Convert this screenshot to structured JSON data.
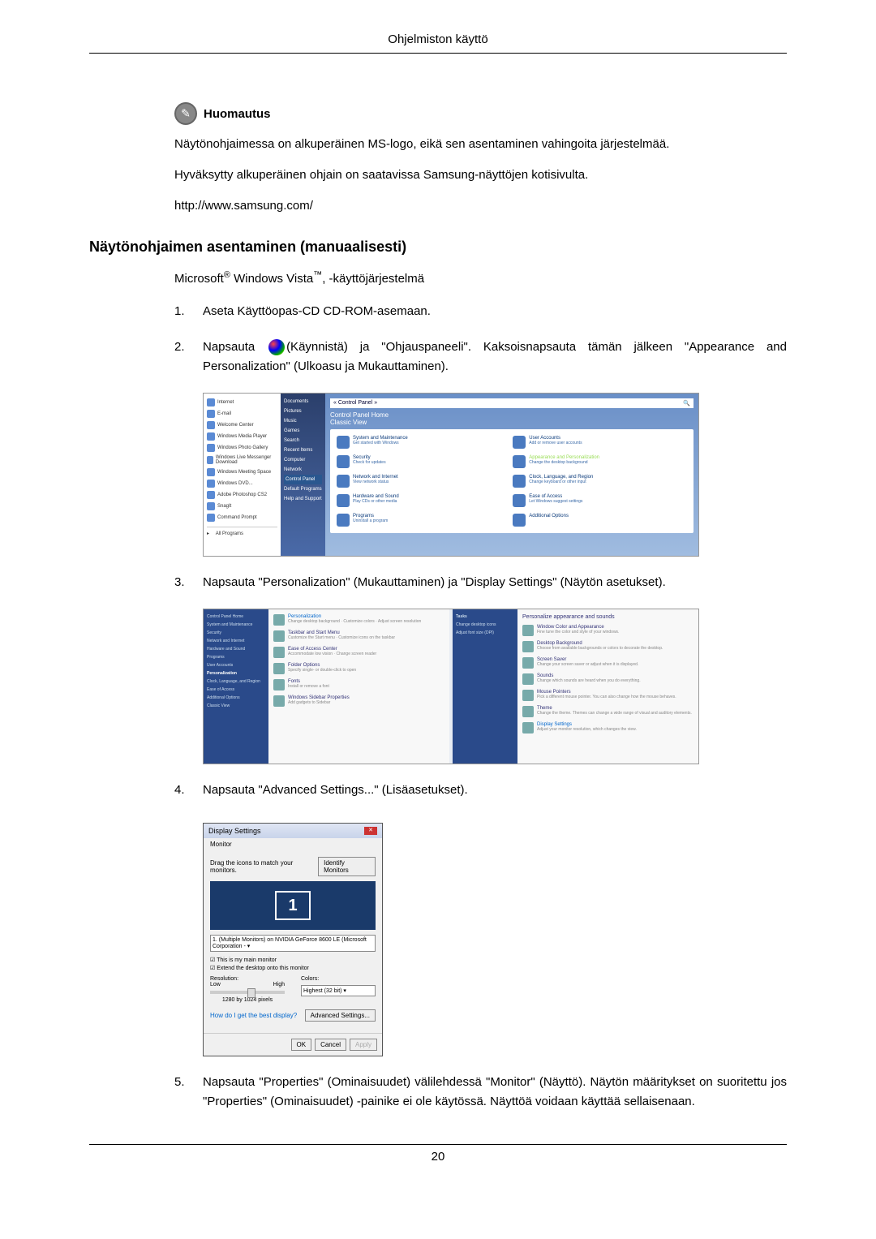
{
  "header": {
    "title": "Ohjelmiston käyttö"
  },
  "note": {
    "heading": "Huomautus",
    "p1": "Näytönohjaimessa on alkuperäinen MS-logo, eikä sen asentaminen vahingoita järjestelmää.",
    "p2": "Hyväksytty alkuperäinen ohjain on saatavissa Samsung-näyttöjen kotisivulta.",
    "p3": "http://www.samsung.com/"
  },
  "section": {
    "heading": "Näytönohjaimen asentaminen (manuaalisesti)"
  },
  "intro": {
    "prefix": "Microsoft",
    "reg": "®",
    "mid": " Windows Vista",
    "tm": "™",
    "suffix": ", -käyttöjärjestelmä"
  },
  "steps": {
    "s1": {
      "num": "1.",
      "text": "Aseta Käyttöopas-CD CD-ROM-asemaan."
    },
    "s2": {
      "num": "2.",
      "pre": "Napsauta ",
      "post": "(Käynnistä) ja \"Ohjauspaneeli\". Kaksoisnapsauta tämän jälkeen \"Appearance and Personalization\" (Ulkoasu ja Mukauttaminen)."
    },
    "s3": {
      "num": "3.",
      "text": "Napsauta \"Personalization\" (Mukauttaminen) ja \"Display Settings\" (Näytön asetukset)."
    },
    "s4": {
      "num": "4.",
      "text": "Napsauta \"Advanced Settings...\" (Lisäasetukset)."
    },
    "s5": {
      "num": "5.",
      "text": "Napsauta \"Properties\" (Ominaisuudet) välilehdessä \"Monitor\" (Näyttö). Näytön määritykset on suoritettu jos \"Properties\" (Ominaisuudet) -painike ei ole käytössä. Näyttöä voidaan käyttää sellaisenaan."
    }
  },
  "cp_screenshot": {
    "addr_path": "« Control Panel »",
    "start_menu_left": [
      "Internet",
      "E-mail",
      "Welcome Center",
      "Windows Media Player",
      "Windows Photo Gallery",
      "Windows Live Messenger Download",
      "Windows Meeting Space",
      "Windows DVD...",
      "Adobe Photoshop CS2",
      "SnagIt",
      "Command Prompt",
      "All Programs"
    ],
    "start_menu_right": [
      "Documents",
      "Pictures",
      "Music",
      "Games",
      "Search",
      "Recent Items",
      "Computer",
      "Network",
      "Control Panel",
      "Default Programs",
      "Help and Support"
    ],
    "cats": [
      {
        "t": "System and Maintenance",
        "s": "Get started with Windows"
      },
      {
        "t": "User Accounts",
        "s": "Add or remove user accounts"
      },
      {
        "t": "Security",
        "s": "Check for updates"
      },
      {
        "t": "Appearance and Personalization",
        "s": "Change the desktop background",
        "hl": true
      },
      {
        "t": "Network and Internet",
        "s": "View network status"
      },
      {
        "t": "Clock, Language, and Region",
        "s": "Change keyboard or other input"
      },
      {
        "t": "Hardware and Sound",
        "s": "Play CDs or other media"
      },
      {
        "t": "Ease of Access",
        "s": "Let Windows suggest settings"
      },
      {
        "t": "Programs",
        "s": "Uninstall a program"
      },
      {
        "t": "Additional Options",
        "s": ""
      }
    ]
  },
  "pers_screenshot": {
    "left_side": [
      "Control Panel Home",
      "System and Maintenance",
      "Security",
      "Network and Internet",
      "Hardware and Sound",
      "Programs",
      "User Accounts",
      "Personalization",
      "Clock, Language, and Region",
      "Ease of Access",
      "Additional Options",
      "Classic View"
    ],
    "left_items": [
      {
        "t": "Personalization",
        "s": "Change desktop background · Customize colors · Adjust screen resolution"
      },
      {
        "t": "Taskbar and Start Menu",
        "s": "Customize the Start menu · Customize icons on the taskbar"
      },
      {
        "t": "Ease of Access Center",
        "s": "Accommodate low vision · Change screen reader"
      },
      {
        "t": "Folder Options",
        "s": "Specify single- or double-click to open"
      },
      {
        "t": "Fonts",
        "s": "Install or remove a font"
      },
      {
        "t": "Windows Sidebar Properties",
        "s": "Add gadgets to Sidebar"
      }
    ],
    "right_side": [
      "Tasks",
      "Change desktop icons",
      "Adjust font size (DPI)"
    ],
    "right_title": "Personalize appearance and sounds",
    "right_items": [
      {
        "t": "Window Color and Appearance",
        "s": "Fine tune the color and style of your windows."
      },
      {
        "t": "Desktop Background",
        "s": "Choose from available backgrounds or colors to decorate the desktop."
      },
      {
        "t": "Screen Saver",
        "s": "Change your screen saver or adjust when it is displayed."
      },
      {
        "t": "Sounds",
        "s": "Change which sounds are heard when you do everything."
      },
      {
        "t": "Mouse Pointers",
        "s": "Pick a different mouse pointer. You can also change how the mouse behaves."
      },
      {
        "t": "Theme",
        "s": "Change the theme. Themes can change a wide range of visual and auditory elements."
      },
      {
        "t": "Display Settings",
        "s": "Adjust your monitor resolution, which changes the view."
      }
    ]
  },
  "disp_screenshot": {
    "title": "Display Settings",
    "tab": "Monitor",
    "instruction": "Drag the icons to match your monitors.",
    "identify": "Identify Monitors",
    "mon_num": "1",
    "dropdown": "1. (Multiple Monitors) on NVIDIA GeForce 8600 LE (Microsoft Corporation - ▾",
    "check1": "This is my main monitor",
    "check2": "Extend the desktop onto this monitor",
    "res_label": "Resolution:",
    "res_low": "Low",
    "res_high": "High",
    "res_val": "1280 by 1024 pixels",
    "col_label": "Colors:",
    "col_val": "Highest (32 bit)   ▾",
    "link": "How do I get the best display?",
    "adv": "Advanced Settings...",
    "ok": "OK",
    "cancel": "Cancel",
    "apply": "Apply"
  },
  "page_num": "20"
}
